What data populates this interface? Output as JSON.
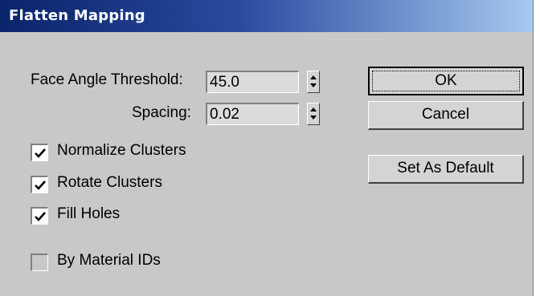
{
  "window": {
    "title": "Flatten Mapping"
  },
  "fields": {
    "face_angle_threshold": {
      "label": "Face Angle Threshold:",
      "value": "45.0"
    },
    "spacing": {
      "label": "Spacing:",
      "value": "0.02"
    }
  },
  "checkboxes": [
    {
      "label": "Normalize Clusters",
      "checked": true
    },
    {
      "label": "Rotate Clusters",
      "checked": true
    },
    {
      "label": "Fill Holes",
      "checked": true
    },
    {
      "label": "By Material IDs",
      "checked": false
    }
  ],
  "buttons": {
    "ok": "OK",
    "cancel": "Cancel",
    "set_default": "Set As Default"
  },
  "colors": {
    "title_gradient_start": "#0a246a",
    "title_gradient_end": "#a6caf0",
    "dialog_bg": "#c8c8c8"
  }
}
